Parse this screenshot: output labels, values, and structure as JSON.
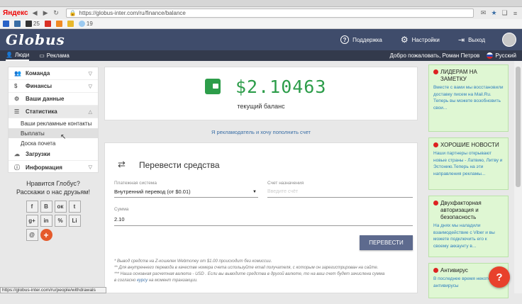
{
  "browser": {
    "logo": "Яндекс",
    "url": "https://globus-inter.com/ru/finance/balance",
    "bookmarks": [
      "25",
      "19"
    ],
    "status_url": "https://globus-inter.com/ru/people/withdrawals"
  },
  "header": {
    "logo": "Globus",
    "support": "Поддержка",
    "settings": "Настройки",
    "logout": "Выход"
  },
  "subnav": {
    "people": "Люди",
    "ads": "Реклама",
    "welcome": "Добро пожаловать, Роман Петров",
    "language": "Русский"
  },
  "sidebar": {
    "items": [
      {
        "label": "Команда"
      },
      {
        "label": "Финансы"
      },
      {
        "label": "Ваши данные"
      },
      {
        "label": "Статистика"
      },
      {
        "label": "Загрузки"
      },
      {
        "label": "Информация"
      }
    ],
    "sub": [
      "Ваши рекламные контакты",
      "Выплаты",
      "Доска почета"
    ]
  },
  "share": {
    "line1": "Нравится Глобус?",
    "line2": "Расскажи о нас друзьям!",
    "buttons": [
      "f",
      "В",
      "ок",
      "t",
      "g+",
      "in",
      "%",
      "Li",
      "@",
      "+"
    ]
  },
  "balance": {
    "amount": "$2.10463",
    "label": "текущий баланс"
  },
  "advertiser_link": "Я рекламодатель и хочу пополнить счет",
  "transfer": {
    "title": "Перевести средства",
    "system_label": "Платежная система",
    "system_value": "Внутренний перевод (от $0.01)",
    "dest_label": "Счет назначения",
    "dest_placeholder": "Введите счёт",
    "amount_label": "Сумма",
    "amount_value": "2.10",
    "submit": "ПЕРЕВЕСТИ",
    "note1": "* Вывод средств на Z-кошелек Webmoney от $1.00 происходит без комиссии.",
    "note2": "** Для внутреннего перевода в качестве номера счета используйте email получателя, с которым он зарегистрирован на сайте.",
    "note3_a": "*** Наша основная расчетная валюта - USD . Если вы выводите средства в другой валюте, то на ваш счет будет зачислена сумма",
    "note3_b": "в согласно",
    "note3_link": "курсу",
    "note3_c": "на момент транзакции."
  },
  "news": [
    {
      "title": "ЛИДЕРАМ НА ЗАМЕТКУ",
      "body": "Вместе с вами мы восстановили доставку писем на Mail.Ru. Теперь вы можете возобновить свои..."
    },
    {
      "title": "ХОРОШИЕ НОВОСТИ",
      "body": "Наши партнеры открывают новые страны - Латвию, Литву и Эстонию.Теперь на эти направления рекламы..."
    },
    {
      "title": "Двухфакторная авторизация и безопасность",
      "body": "На днях мы наладили взаимодействие с Viber и вы можете подключить его к своему аккаунту в..."
    },
    {
      "title": "Антивирус",
      "body": "В последнее время некоторые антивирусы"
    }
  ],
  "help": "?"
}
